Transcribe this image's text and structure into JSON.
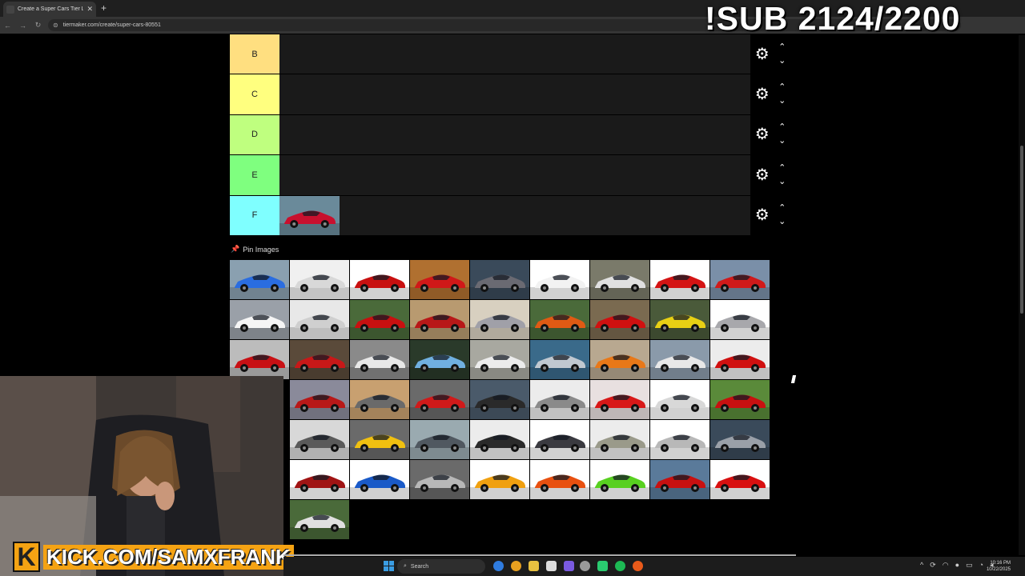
{
  "browser": {
    "tab_title": "Create a Super Cars Tier List - T",
    "tab_close": "✕",
    "new_tab": "+",
    "url": "tiermaker.com/create/super-cars-80551",
    "nav_back": "←",
    "nav_forward": "→",
    "nav_reload": "↻"
  },
  "overlay": {
    "sub_goal": "!SUB 2124/2200",
    "kick_url": "KICK.COM/SAMXFRANK",
    "kick_logo": "K"
  },
  "tiers": [
    {
      "label": "B",
      "color": "#ffdf80"
    },
    {
      "label": "C",
      "color": "#ffff7f"
    },
    {
      "label": "D",
      "color": "#bfff7f"
    },
    {
      "label": "E",
      "color": "#7fff7f"
    },
    {
      "label": "F",
      "color": "#7fffff"
    }
  ],
  "tier_controls": {
    "gear": "⚙",
    "up": "⌃",
    "down": "⌄"
  },
  "pin_images": {
    "label": "Pin Images",
    "icon": "pin-icon"
  },
  "placed_items": {
    "F": [
      {
        "body": "#c8102e",
        "bg": "#6a8a9a"
      }
    ]
  },
  "pool_rows": [
    [
      {
        "body": "#2a6de0",
        "bg": "#8aa0b0"
      },
      {
        "body": "#d8d8d8",
        "bg": "#f0f0f0"
      },
      {
        "body": "#c81010",
        "bg": "#ffffff"
      },
      {
        "body": "#d01818",
        "bg": "#b07030"
      },
      {
        "body": "#6a6a72",
        "bg": "#3a4a5a"
      },
      {
        "body": "#f2f2f2",
        "bg": "#ffffff"
      },
      {
        "body": "#e0e0e0",
        "bg": "#7a7a6a"
      },
      {
        "body": "#d41414",
        "bg": "#ffffff"
      },
      {
        "body": "#d01a1a",
        "bg": "#7a8fa8"
      }
    ],
    [
      {
        "body": "#f5f5f5",
        "bg": "#9aa0a8"
      },
      {
        "body": "#cfcfcf",
        "bg": "#e8e8e8"
      },
      {
        "body": "#c81010",
        "bg": "#4a6a3a"
      },
      {
        "body": "#b81818",
        "bg": "#b89a70"
      },
      {
        "body": "#a0a0a8",
        "bg": "#d8d0c0"
      },
      {
        "body": "#e05a14",
        "bg": "#4a6a3a"
      },
      {
        "body": "#d01010",
        "bg": "#7a6a50"
      },
      {
        "body": "#e8d014",
        "bg": "#4a5a3a"
      },
      {
        "body": "#a8a8ac",
        "bg": "#ffffff"
      }
    ],
    [
      {
        "body": "#c81014",
        "bg": "#bcbcbc"
      },
      {
        "body": "#c81818",
        "bg": "#5a4a3a"
      },
      {
        "body": "#e8e8e8",
        "bg": "#8a8a8a"
      },
      {
        "body": "#70b0e0",
        "bg": "#2a3a2a"
      },
      {
        "body": "#ececec",
        "bg": "#a8a8a0"
      },
      {
        "body": "#c0c8d0",
        "bg": "#3a6a8a"
      },
      {
        "body": "#e87818",
        "bg": "#b8a890"
      },
      {
        "body": "#e8e8e8",
        "bg": "#8a9aaa"
      },
      {
        "body": "#d01010",
        "bg": "#ececec"
      }
    ],
    [
      {
        "body": "#b81818",
        "bg": "#8a8a9a"
      },
      {
        "body": "#6a6a6a",
        "bg": "#c8a070"
      },
      {
        "body": "#d01a1a",
        "bg": "#6a6a6a"
      },
      {
        "body": "#2a2a2a",
        "bg": "#4a5a6a"
      },
      {
        "body": "#8a8a8a",
        "bg": "#ececec"
      },
      {
        "body": "#d81818",
        "bg": "#e8e0e0"
      },
      {
        "body": "#d8d8d8",
        "bg": "#ffffff"
      },
      {
        "body": "#c81010",
        "bg": "#5a8a3a"
      }
    ],
    [
      {
        "body": "#5a5a5a",
        "bg": "#d8d8d8"
      },
      {
        "body": "#f0c010",
        "bg": "#6a6a6a"
      },
      {
        "body": "#505860",
        "bg": "#9aaab0"
      },
      {
        "body": "#2a2a2a",
        "bg": "#ececec"
      },
      {
        "body": "#3a3a40",
        "bg": "#ffffff"
      },
      {
        "body": "#9a9a8a",
        "bg": "#ececec"
      },
      {
        "body": "#b8b8b8",
        "bg": "#ffffff"
      },
      {
        "body": "#9aa0a8",
        "bg": "#3a4a5a"
      }
    ],
    [
      {
        "body": "#a01414",
        "bg": "#ffffff"
      },
      {
        "body": "#1a5ac8",
        "bg": "#ffffff"
      },
      {
        "body": "#b8b8b8",
        "bg": "#6a6a6a"
      },
      {
        "body": "#f0a010",
        "bg": "#ffffff"
      },
      {
        "body": "#e85010",
        "bg": "#ffffff"
      },
      {
        "body": "#58d020",
        "bg": "#ffffff"
      },
      {
        "body": "#c81010",
        "bg": "#5a7a9a"
      },
      {
        "body": "#d81010",
        "bg": "#ffffff"
      }
    ],
    [
      {
        "body": "#e0e0e0",
        "bg": "#4a6a3a"
      }
    ]
  ],
  "taskbar": {
    "search_label": "Search",
    "time": "10:16 PM",
    "date": "10/22/2025"
  }
}
